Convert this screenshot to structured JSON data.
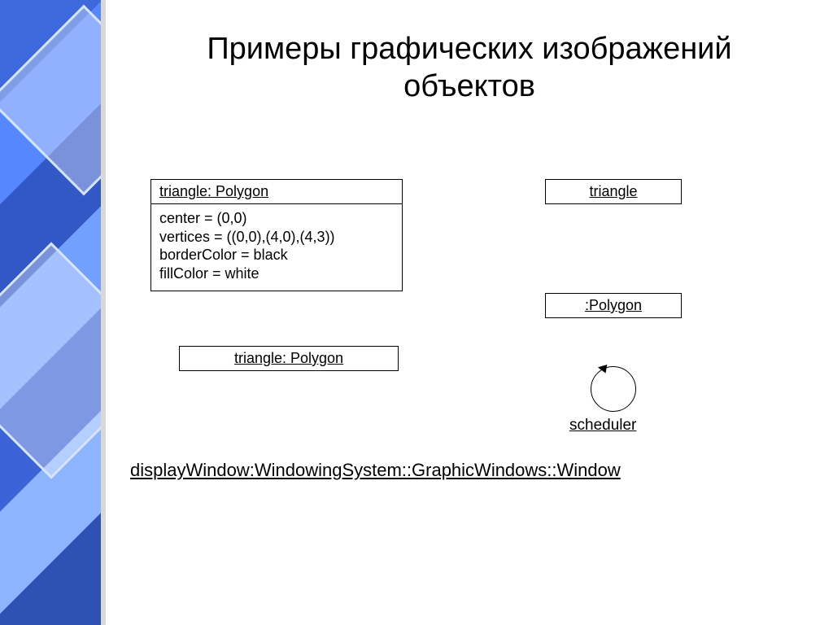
{
  "title": "Примеры графических изображений объектов",
  "objects": {
    "trianglePolygonFull": {
      "name": "triangle: Polygon",
      "attributes": "center = (0,0)\nvertices = ((0,0),(4,0),(4,3))\nborderColor = black\nfillColor = white"
    },
    "triangleOnly": {
      "name": "triangle"
    },
    "polygonAnon": {
      "name": ":Polygon"
    },
    "trianglePolygonShort": {
      "name": "triangle: Polygon"
    },
    "scheduler": {
      "name": "scheduler"
    },
    "longQualified": {
      "name": "displayWindow:WindowingSystem::GraphicWindows::Window"
    }
  }
}
